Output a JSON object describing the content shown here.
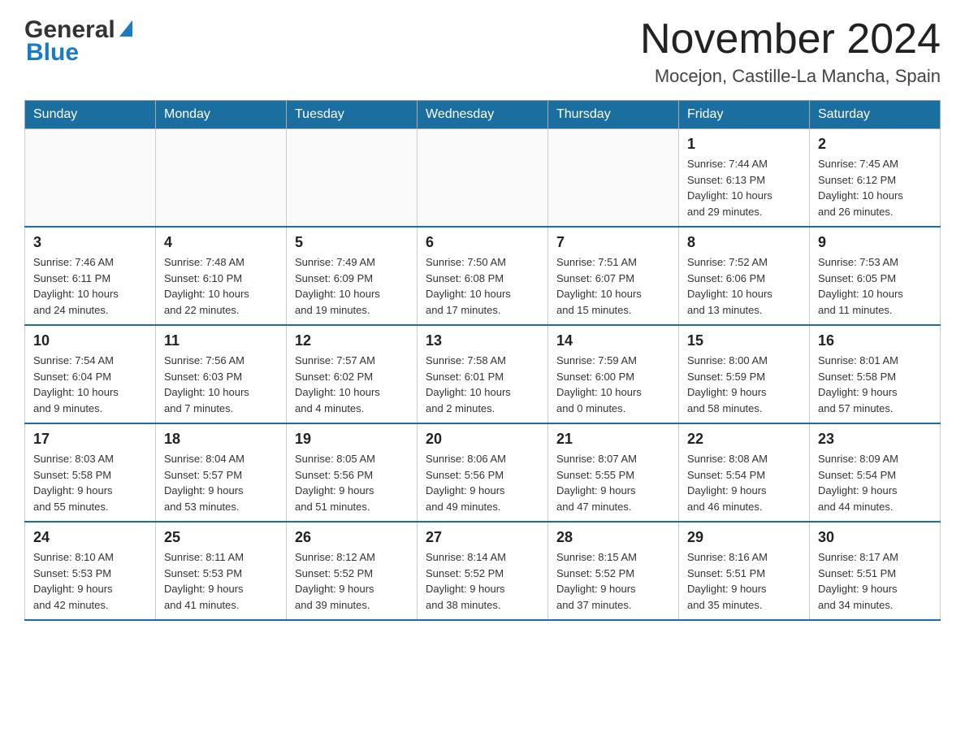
{
  "header": {
    "logo_general": "General",
    "logo_blue": "Blue",
    "title": "November 2024",
    "subtitle": "Mocejon, Castille-La Mancha, Spain"
  },
  "calendar": {
    "days_of_week": [
      "Sunday",
      "Monday",
      "Tuesday",
      "Wednesday",
      "Thursday",
      "Friday",
      "Saturday"
    ],
    "weeks": [
      [
        {
          "day": "",
          "info": ""
        },
        {
          "day": "",
          "info": ""
        },
        {
          "day": "",
          "info": ""
        },
        {
          "day": "",
          "info": ""
        },
        {
          "day": "",
          "info": ""
        },
        {
          "day": "1",
          "info": "Sunrise: 7:44 AM\nSunset: 6:13 PM\nDaylight: 10 hours\nand 29 minutes."
        },
        {
          "day": "2",
          "info": "Sunrise: 7:45 AM\nSunset: 6:12 PM\nDaylight: 10 hours\nand 26 minutes."
        }
      ],
      [
        {
          "day": "3",
          "info": "Sunrise: 7:46 AM\nSunset: 6:11 PM\nDaylight: 10 hours\nand 24 minutes."
        },
        {
          "day": "4",
          "info": "Sunrise: 7:48 AM\nSunset: 6:10 PM\nDaylight: 10 hours\nand 22 minutes."
        },
        {
          "day": "5",
          "info": "Sunrise: 7:49 AM\nSunset: 6:09 PM\nDaylight: 10 hours\nand 19 minutes."
        },
        {
          "day": "6",
          "info": "Sunrise: 7:50 AM\nSunset: 6:08 PM\nDaylight: 10 hours\nand 17 minutes."
        },
        {
          "day": "7",
          "info": "Sunrise: 7:51 AM\nSunset: 6:07 PM\nDaylight: 10 hours\nand 15 minutes."
        },
        {
          "day": "8",
          "info": "Sunrise: 7:52 AM\nSunset: 6:06 PM\nDaylight: 10 hours\nand 13 minutes."
        },
        {
          "day": "9",
          "info": "Sunrise: 7:53 AM\nSunset: 6:05 PM\nDaylight: 10 hours\nand 11 minutes."
        }
      ],
      [
        {
          "day": "10",
          "info": "Sunrise: 7:54 AM\nSunset: 6:04 PM\nDaylight: 10 hours\nand 9 minutes."
        },
        {
          "day": "11",
          "info": "Sunrise: 7:56 AM\nSunset: 6:03 PM\nDaylight: 10 hours\nand 7 minutes."
        },
        {
          "day": "12",
          "info": "Sunrise: 7:57 AM\nSunset: 6:02 PM\nDaylight: 10 hours\nand 4 minutes."
        },
        {
          "day": "13",
          "info": "Sunrise: 7:58 AM\nSunset: 6:01 PM\nDaylight: 10 hours\nand 2 minutes."
        },
        {
          "day": "14",
          "info": "Sunrise: 7:59 AM\nSunset: 6:00 PM\nDaylight: 10 hours\nand 0 minutes."
        },
        {
          "day": "15",
          "info": "Sunrise: 8:00 AM\nSunset: 5:59 PM\nDaylight: 9 hours\nand 58 minutes."
        },
        {
          "day": "16",
          "info": "Sunrise: 8:01 AM\nSunset: 5:58 PM\nDaylight: 9 hours\nand 57 minutes."
        }
      ],
      [
        {
          "day": "17",
          "info": "Sunrise: 8:03 AM\nSunset: 5:58 PM\nDaylight: 9 hours\nand 55 minutes."
        },
        {
          "day": "18",
          "info": "Sunrise: 8:04 AM\nSunset: 5:57 PM\nDaylight: 9 hours\nand 53 minutes."
        },
        {
          "day": "19",
          "info": "Sunrise: 8:05 AM\nSunset: 5:56 PM\nDaylight: 9 hours\nand 51 minutes."
        },
        {
          "day": "20",
          "info": "Sunrise: 8:06 AM\nSunset: 5:56 PM\nDaylight: 9 hours\nand 49 minutes."
        },
        {
          "day": "21",
          "info": "Sunrise: 8:07 AM\nSunset: 5:55 PM\nDaylight: 9 hours\nand 47 minutes."
        },
        {
          "day": "22",
          "info": "Sunrise: 8:08 AM\nSunset: 5:54 PM\nDaylight: 9 hours\nand 46 minutes."
        },
        {
          "day": "23",
          "info": "Sunrise: 8:09 AM\nSunset: 5:54 PM\nDaylight: 9 hours\nand 44 minutes."
        }
      ],
      [
        {
          "day": "24",
          "info": "Sunrise: 8:10 AM\nSunset: 5:53 PM\nDaylight: 9 hours\nand 42 minutes."
        },
        {
          "day": "25",
          "info": "Sunrise: 8:11 AM\nSunset: 5:53 PM\nDaylight: 9 hours\nand 41 minutes."
        },
        {
          "day": "26",
          "info": "Sunrise: 8:12 AM\nSunset: 5:52 PM\nDaylight: 9 hours\nand 39 minutes."
        },
        {
          "day": "27",
          "info": "Sunrise: 8:14 AM\nSunset: 5:52 PM\nDaylight: 9 hours\nand 38 minutes."
        },
        {
          "day": "28",
          "info": "Sunrise: 8:15 AM\nSunset: 5:52 PM\nDaylight: 9 hours\nand 37 minutes."
        },
        {
          "day": "29",
          "info": "Sunrise: 8:16 AM\nSunset: 5:51 PM\nDaylight: 9 hours\nand 35 minutes."
        },
        {
          "day": "30",
          "info": "Sunrise: 8:17 AM\nSunset: 5:51 PM\nDaylight: 9 hours\nand 34 minutes."
        }
      ]
    ]
  }
}
